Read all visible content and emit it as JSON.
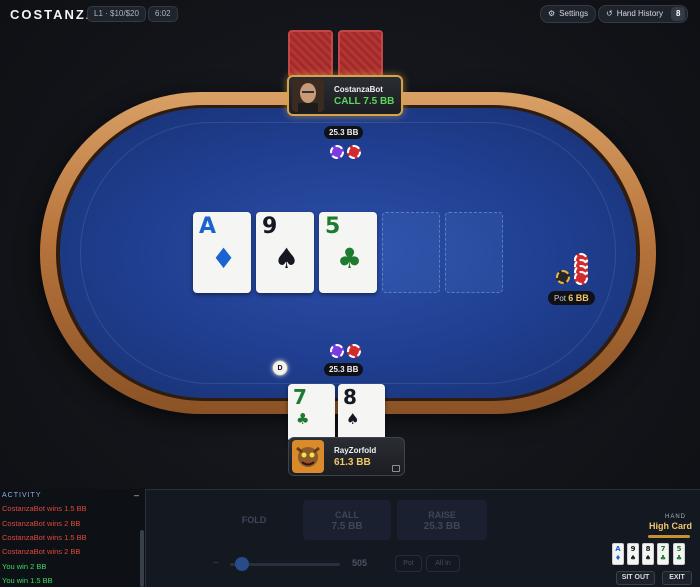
{
  "header": {
    "brand": "COSTANZA",
    "stakes": "L1 · $10/$20",
    "clock": "6:02",
    "settings_label": "Settings",
    "history_label": "Hand History",
    "history_count": "8",
    "settings_icon": "gear-icon",
    "history_icon": "history-icon"
  },
  "board": [
    {
      "rank": "A",
      "suit": "♦",
      "color": "#1b63d0"
    },
    {
      "rank": "9",
      "suit": "♠",
      "color": "#151821"
    },
    {
      "rank": "5",
      "suit": "♣",
      "color": "#1d7a2e"
    }
  ],
  "opponent": {
    "name": "CostanzaBot",
    "action": "CALL 7.5 BB",
    "bet": "25.3 BB"
  },
  "hero": {
    "name": "RayZorfold",
    "stack": "61.3 BB",
    "bet": "25.3 BB",
    "cards": [
      {
        "rank": "7",
        "suit": "♣",
        "color": "#1d7a2e"
      },
      {
        "rank": "8",
        "suit": "♠",
        "color": "#151821"
      }
    ]
  },
  "dealer_button": "D",
  "pot": {
    "label": "Pot",
    "value": "6 BB"
  },
  "activity": {
    "title": "ACTIVITY",
    "collapse": "–",
    "lines": [
      {
        "text": "CostanzaBot wins 1.5 BB",
        "type": "red"
      },
      {
        "text": "CostanzaBot wins 2 BB",
        "type": "red"
      },
      {
        "text": "CostanzaBot wins 1.5 BB",
        "type": "red"
      },
      {
        "text": "CostanzaBot wins 2 BB",
        "type": "red"
      },
      {
        "text": "You win 2 BB",
        "type": "green"
      },
      {
        "text": "You win 1.5 BB",
        "type": "green"
      }
    ]
  },
  "actions": {
    "fold": "FOLD",
    "call": "CALL",
    "call_amount": "7.5 BB",
    "raise": "RAISE",
    "raise_amount": "25.3 BB",
    "minus": "–",
    "amount": "505",
    "pot": "Pot",
    "allin": "All In"
  },
  "hand": {
    "label": "HAND",
    "value": "High Card",
    "cards": [
      "A",
      "9",
      "8",
      "7",
      "5"
    ],
    "suits": [
      "♦",
      "♠",
      "♠",
      "♣",
      "♣"
    ],
    "card_colors": [
      "#1b63d0",
      "#151821",
      "#151821",
      "#1d7a2e",
      "#1d7a2e"
    ],
    "sit_out": "SIT OUT",
    "exit": "EXIT"
  }
}
